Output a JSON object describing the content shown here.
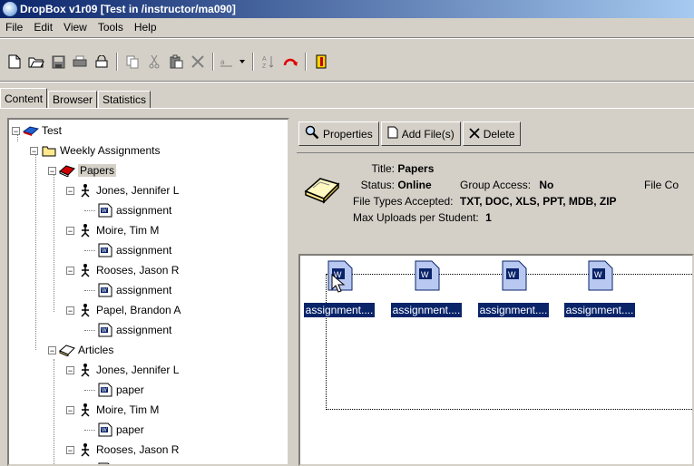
{
  "window": {
    "title": "DropBox v1r09 [Test in /instructor/ma090]"
  },
  "menu": [
    "File",
    "Edit",
    "View",
    "Tools",
    "Help"
  ],
  "toolbar": [
    "new-file-icon",
    "open-folder-icon",
    "save-icon",
    "print-icon",
    "lock-icon",
    "copy-icon",
    "cut-icon",
    "paste-icon",
    "delete-icon",
    "rename-dropdown-icon",
    "sort-icon",
    "refresh-icon",
    "exit-icon"
  ],
  "tabs": [
    {
      "label": "Content",
      "active": true
    },
    {
      "label": "Browser",
      "active": false
    },
    {
      "label": "Statistics",
      "active": false
    }
  ],
  "tree": {
    "root": "Test",
    "folder": "Weekly Assignments",
    "groups": [
      {
        "label": "Papers",
        "selected": true,
        "students": [
          {
            "name": "Jones, Jennifer L",
            "file": "assignment"
          },
          {
            "name": "Moire, Tim M",
            "file": "assignment"
          },
          {
            "name": "Rooses, Jason R",
            "file": "assignment"
          },
          {
            "name": "Papel, Brandon A",
            "file": "assignment"
          }
        ]
      },
      {
        "label": "Articles",
        "selected": false,
        "students": [
          {
            "name": "Jones, Jennifer L",
            "file": "paper"
          },
          {
            "name": "Moire, Tim M",
            "file": "paper"
          },
          {
            "name": "Rooses, Jason R",
            "file": ""
          }
        ]
      }
    ]
  },
  "buttons": {
    "properties": "Properties",
    "add_files": "Add File(s)",
    "delete": "Delete"
  },
  "info": {
    "title_label": "Title:",
    "title_value": "Papers",
    "status_label": "Status:",
    "status_value": "Online",
    "group_access_label": "Group Access:",
    "group_access_value": "No",
    "file_co_label": "File Co",
    "file_types_label": "File Types Accepted:",
    "file_types_value": "TXT, DOC, XLS, PPT, MDB, ZIP",
    "max_uploads_label": "Max Uploads per Student:",
    "max_uploads_value": "1"
  },
  "files": [
    "assignment....",
    "assignment....",
    "assignment....",
    "assignment...."
  ],
  "colors": {
    "title_start": "#0a246a",
    "title_end": "#a6caf0",
    "selection": "#0a246a",
    "face": "#d4d0c8"
  }
}
